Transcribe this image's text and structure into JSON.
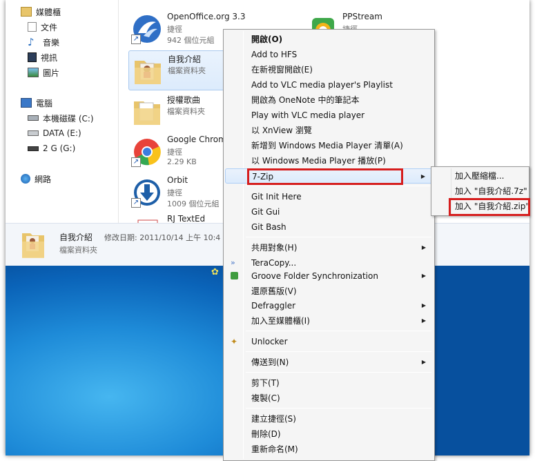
{
  "nav": {
    "libraries": {
      "label": "媒體櫃",
      "items": [
        "文件",
        "音樂",
        "視訊",
        "圖片"
      ]
    },
    "computer": {
      "label": "電腦",
      "drives": [
        "本機磁碟 (C:)",
        "DATA (E:)",
        "2 G (G:)"
      ]
    },
    "network": {
      "label": "網路"
    }
  },
  "files": [
    {
      "name": "OpenOffice.org 3.3",
      "type": "捷徑",
      "size": "942 個位元組"
    },
    {
      "name": "PPStream",
      "type": "捷徑",
      "size": ""
    },
    {
      "name": "自我介紹",
      "type": "檔案資料夾",
      "size": ""
    },
    {
      "name": "授權歌曲",
      "type": "檔案資料夾",
      "size": ""
    },
    {
      "name": "Google Chrome",
      "type": "捷徑",
      "size": "2.29 KB"
    },
    {
      "name": "Orbit",
      "type": "捷徑",
      "size": "1009 個位元組"
    },
    {
      "name": "RJ TextEd",
      "type": "",
      "size": ""
    }
  ],
  "details": {
    "name": "自我介紹",
    "modified": "修改日期: 2011/10/14 上午 10:4",
    "type": "檔案資料夾"
  },
  "context_menu": {
    "items": [
      "開啟(O)",
      "Add to HFS",
      "在新視窗開啟(E)",
      "Add to VLC media player's Playlist",
      "開啟為 OneNote 中的筆記本",
      "Play with VLC media player",
      "以 XnView 瀏覽",
      "新增到 Windows Media Player 清單(A)",
      "以 Windows Media Player 播放(P)",
      "7-Zip",
      "Git Init Here",
      "Git Gui",
      "Git Bash",
      "共用對象(H)",
      "TeraCopy...",
      "Groove Folder Synchronization",
      "還原舊版(V)",
      "Defraggler",
      "加入至媒體櫃(I)",
      "Unlocker",
      "傳送到(N)",
      "剪下(T)",
      "複製(C)",
      "建立捷徑(S)",
      "刪除(D)",
      "重新命名(M)"
    ]
  },
  "submenu_7zip": {
    "items": [
      "加入壓縮檔...",
      "加入 \"自我介紹.7z\"",
      "加入 \"自我介紹.zip\""
    ]
  },
  "colors": {
    "highlight_box": "#d61d1d",
    "menu_bg": "#f5f5f5",
    "desktop": "#1e8bd8"
  }
}
